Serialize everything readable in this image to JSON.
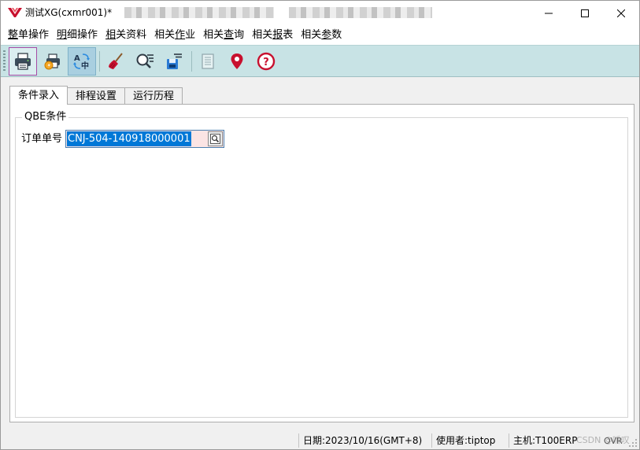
{
  "window": {
    "title": "测试XG(cxmr001)*",
    "controls": [
      "minimize-icon",
      "maximize-icon",
      "close-icon"
    ]
  },
  "menu": {
    "items": [
      {
        "label": "整单操作",
        "accel": "整"
      },
      {
        "label": "明细操作",
        "accel": "明"
      },
      {
        "label": "相关资料",
        "accel": "相"
      },
      {
        "label": "相关作业",
        "accel": "作"
      },
      {
        "label": "相关查询",
        "accel": "查"
      },
      {
        "label": "相关报表",
        "accel": "报"
      },
      {
        "label": "相关参数",
        "accel": "参"
      }
    ]
  },
  "toolbar": {
    "buttons": [
      {
        "icon": "printer-icon",
        "state": "selected"
      },
      {
        "icon": "quick-print-icon",
        "state": "normal"
      },
      {
        "icon": "language-switch-icon",
        "state": "pressed"
      },
      {
        "icon": "clear-broom-icon",
        "state": "normal"
      },
      {
        "icon": "query-search-icon",
        "state": "normal"
      },
      {
        "icon": "save-disk-icon",
        "state": "normal"
      },
      {
        "icon": "document-list-icon",
        "state": "disabled"
      },
      {
        "icon": "location-pin-icon",
        "state": "normal"
      },
      {
        "icon": "help-question-icon",
        "state": "normal"
      }
    ],
    "colors": {
      "background": "#c8e3e5",
      "pin": "#c8102e",
      "help": "#c8102e"
    }
  },
  "tabs": [
    {
      "label": "条件录入",
      "active": true
    },
    {
      "label": "排程设置",
      "active": false
    },
    {
      "label": "运行历程",
      "active": false
    }
  ],
  "qbe": {
    "group_title": "QBE条件",
    "order_label": "订单单号",
    "order_value": "CNJ-504-140918000001"
  },
  "status": {
    "date": "日期:2023/10/16(GMT+8)",
    "user": "使用者:tiptop",
    "host": "主机:T100ERP",
    "watermark": "CSDN @听叹",
    "mode": "OVR"
  }
}
